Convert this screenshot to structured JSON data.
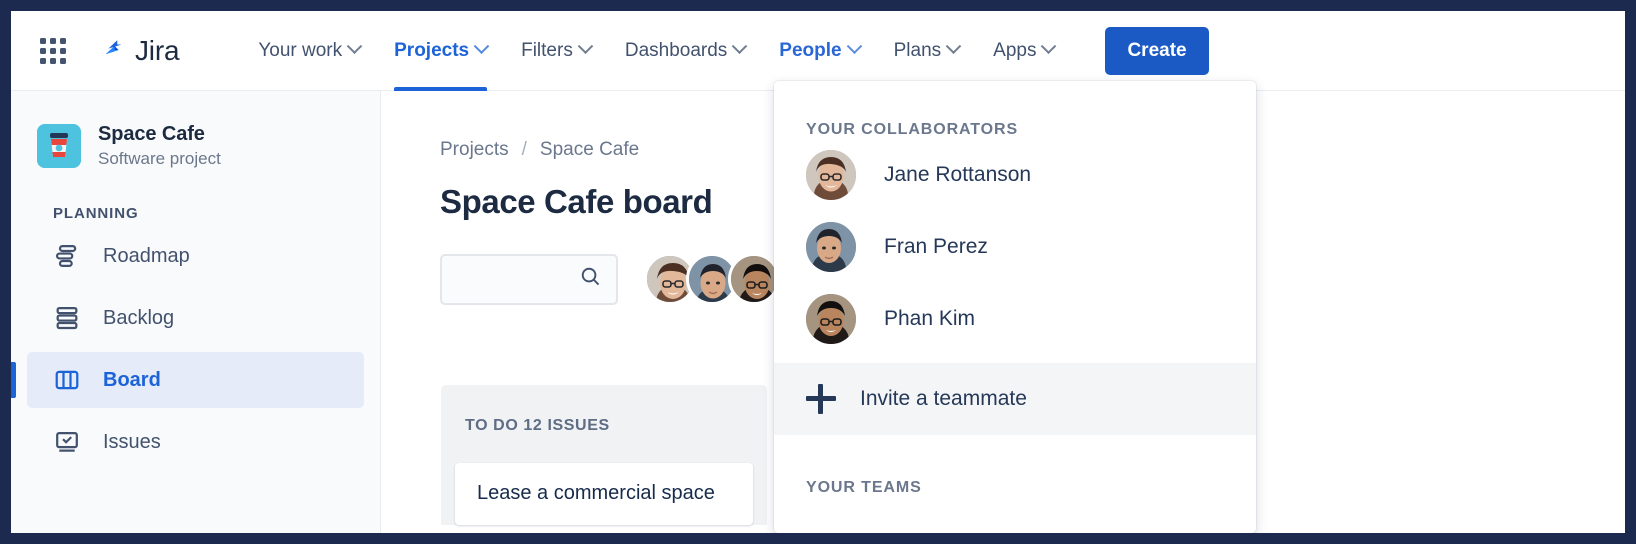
{
  "window": {
    "frame_color": "#1b2a4e"
  },
  "topnav": {
    "app_switcher_icon": "grid-apps-icon",
    "logo_text": "Jira",
    "items": [
      {
        "label": "Your work",
        "state": "default",
        "caret": true
      },
      {
        "label": "Projects",
        "state": "active",
        "caret": true
      },
      {
        "label": "Filters",
        "state": "default",
        "caret": true
      },
      {
        "label": "Dashboards",
        "state": "default",
        "caret": true
      },
      {
        "label": "People",
        "state": "highlight",
        "caret": true
      },
      {
        "label": "Plans",
        "state": "default",
        "caret": true
      },
      {
        "label": "Apps",
        "state": "default",
        "caret": true
      }
    ],
    "create_label": "Create",
    "create_color": "#1b5ac4",
    "active_color": "#1d63d8"
  },
  "sidebar": {
    "project_name": "Space Cafe",
    "project_type": "Software project",
    "project_icon": "coffee-cup-icon",
    "project_icon_color": "#4ec3e0",
    "section_label": "PLANNING",
    "items": [
      {
        "label": "Roadmap",
        "icon": "roadmap-icon",
        "selected": false
      },
      {
        "label": "Backlog",
        "icon": "backlog-icon",
        "selected": false
      },
      {
        "label": "Board",
        "icon": "board-icon",
        "selected": true
      },
      {
        "label": "Issues",
        "icon": "issues-icon",
        "selected": false
      }
    ],
    "selected_bg": "#e5ebf8",
    "selected_color": "#1d63d8"
  },
  "main": {
    "breadcrumb": {
      "parent": "Projects",
      "separator": "/",
      "current": "Space Cafe"
    },
    "page_title": "Space Cafe board",
    "search": {
      "value": "",
      "placeholder": "",
      "icon": "search-icon"
    },
    "avatars": [
      {
        "name": "avatar-jane"
      },
      {
        "name": "avatar-fran"
      },
      {
        "name": "avatar-phan"
      }
    ],
    "column": {
      "header": "TO DO 12 ISSUES",
      "cards": [
        {
          "title": "Lease a commercial space"
        }
      ]
    }
  },
  "dropdown": {
    "collaborators_label": "YOUR COLLABORATORS",
    "people": [
      {
        "name": "Jane Rottanson"
      },
      {
        "name": "Fran Perez"
      },
      {
        "name": "Phan Kim"
      }
    ],
    "invite_label": "Invite a teammate",
    "invite_icon": "plus-icon",
    "teams_label": "YOUR TEAMS"
  }
}
